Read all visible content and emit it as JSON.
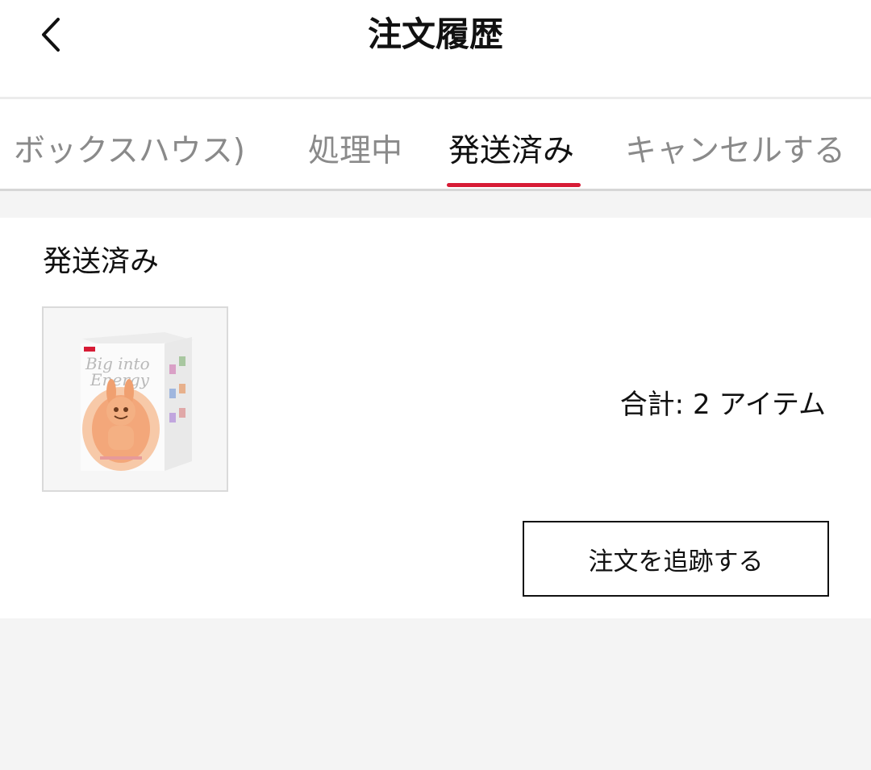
{
  "header": {
    "title": "注文履歴",
    "back_icon": "chevron-left-icon"
  },
  "tabs": [
    {
      "label": "ボックスハウス)",
      "active": false
    },
    {
      "label": "処理中",
      "active": false
    },
    {
      "label": "発送済み",
      "active": true
    },
    {
      "label": "キャンセルする",
      "active": false
    }
  ],
  "colors": {
    "accent": "#d71b35",
    "background": "#f4f4f4"
  },
  "order": {
    "status": "発送済み",
    "total": "合計: 2 アイテム",
    "product_image": "blind-box-product-image",
    "track_button": "注文を追跡する"
  }
}
